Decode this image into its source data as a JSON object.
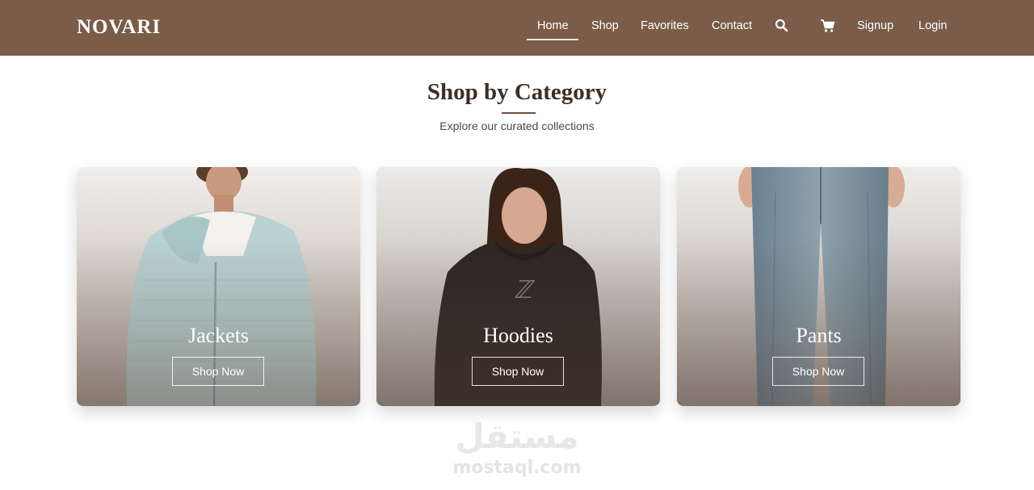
{
  "header": {
    "brand": "NOVARI",
    "nav": {
      "home": "Home",
      "shop": "Shop",
      "favorites": "Favorites",
      "contact": "Contact",
      "signup": "Signup",
      "login": "Login"
    },
    "icons": {
      "search": "search-icon",
      "cart": "cart-icon"
    },
    "background_color": "#7a5c48"
  },
  "section": {
    "title": "Shop by Category",
    "subtitle": "Explore our curated collections"
  },
  "categories": [
    {
      "name": "Jackets",
      "button": "Shop Now",
      "image": "woman-in-light-blue-knit-zip-jacket"
    },
    {
      "name": "Hoodies",
      "button": "Shop Now",
      "image": "woman-in-dark-brown-hoodie"
    },
    {
      "name": "Pants",
      "button": "Shop Now",
      "image": "light-wash-wide-leg-jeans"
    }
  ],
  "watermark": {
    "arabic": "مستقل",
    "latin": "mostaql.com"
  }
}
